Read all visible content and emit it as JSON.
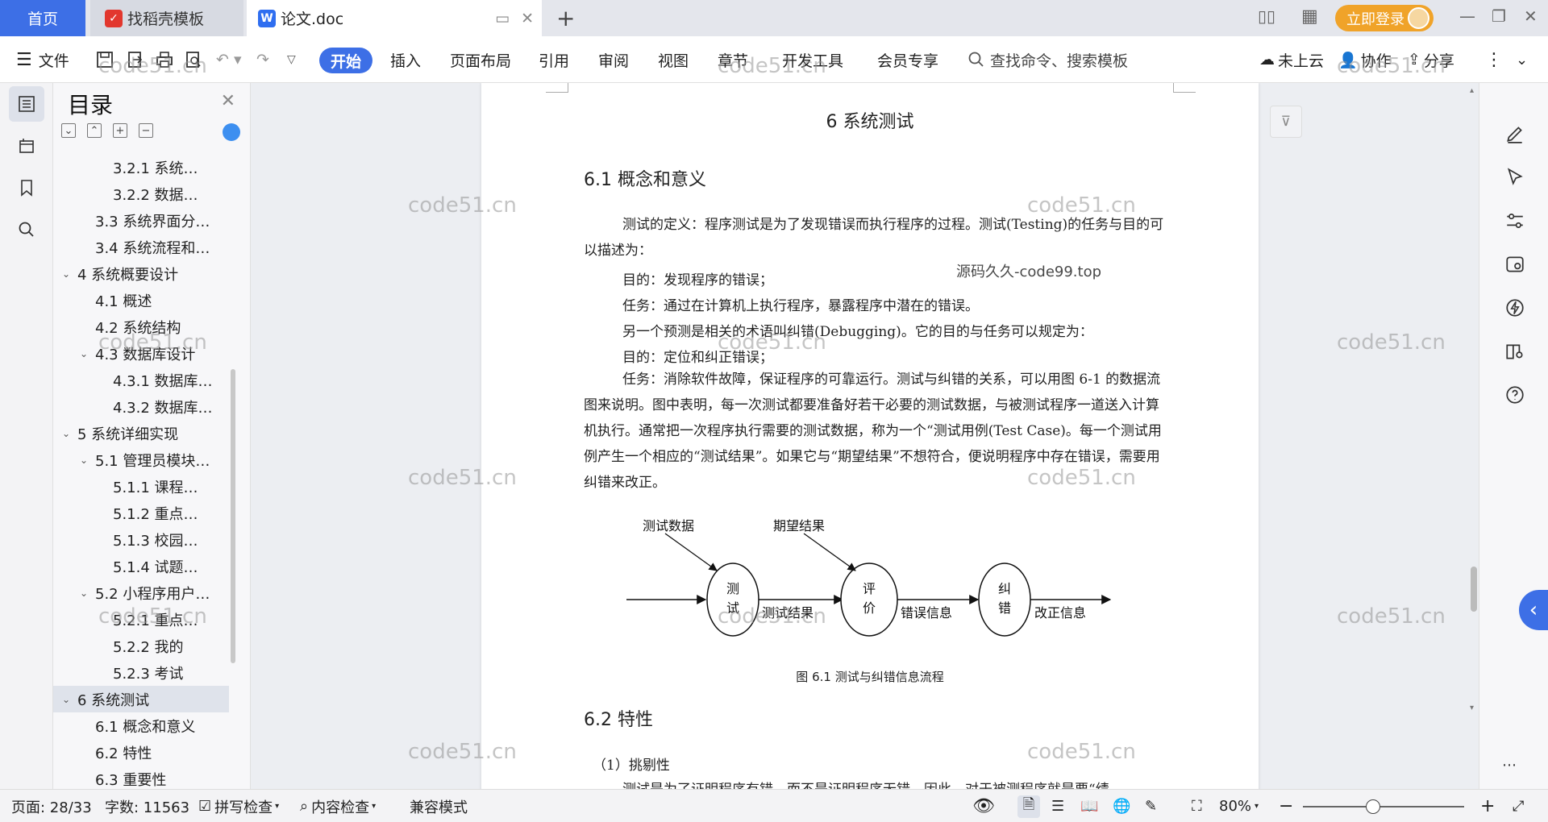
{
  "tabs": [
    {
      "label": "首页"
    },
    {
      "label": "找稻壳模板"
    },
    {
      "label": "论文.doc"
    }
  ],
  "header": {
    "login_label": "立即登录"
  },
  "menu": {
    "file_label": "文件",
    "items": [
      "开始",
      "插入",
      "页面布局",
      "引用",
      "审阅",
      "视图",
      "章节",
      "开发工具",
      "会员专享"
    ],
    "search_placeholder": "查找命令、搜索模板",
    "cloud_label": "未上云",
    "collab_label": "协作",
    "share_label": "分享"
  },
  "toc": {
    "title": "目录",
    "items": [
      {
        "label": "3.2.1 系统…",
        "level": 3
      },
      {
        "label": "3.2.2 数据…",
        "level": 3
      },
      {
        "label": "3.3 系统界面分…",
        "level": 2
      },
      {
        "label": "3.4 系统流程和…",
        "level": 2
      },
      {
        "label": "4 系统概要设计",
        "level": 1,
        "expanded": true
      },
      {
        "label": "4.1 概述",
        "level": 2
      },
      {
        "label": "4.2 系统结构",
        "level": 2
      },
      {
        "label": "4.3 数据库设计",
        "level": 2,
        "expanded": true
      },
      {
        "label": "4.3.1 数据库…",
        "level": 3
      },
      {
        "label": "4.3.2 数据库…",
        "level": 3
      },
      {
        "label": "5 系统详细实现",
        "level": 1,
        "expanded": true
      },
      {
        "label": "5.1 管理员模块…",
        "level": 2,
        "expanded": true
      },
      {
        "label": "5.1.1 课程…",
        "level": 3
      },
      {
        "label": "5.1.2 重点…",
        "level": 3
      },
      {
        "label": "5.1.3 校园…",
        "level": 3
      },
      {
        "label": "5.1.4 试题…",
        "level": 3
      },
      {
        "label": "5.2 小程序用户…",
        "level": 2,
        "expanded": true
      },
      {
        "label": "5.2.1 重点…",
        "level": 3
      },
      {
        "label": "5.2.2 我的",
        "level": 3
      },
      {
        "label": "5.2.3 考试",
        "level": 3
      },
      {
        "label": "6 系统测试",
        "level": 1,
        "expanded": true,
        "active": true
      },
      {
        "label": "6.1 概念和意义",
        "level": 2
      },
      {
        "label": "6.2 特性",
        "level": 2
      },
      {
        "label": "6.3 重要性",
        "level": 2
      }
    ]
  },
  "document": {
    "chapter_title": "6 系统测试",
    "section_1_title": "6.1 概念和意义",
    "para_1": "测试的定义：程序测试是为了发现错误而执行程序的过程。测试(Testing)的任务与目的可以描述为：",
    "line_1": "目的：发现程序的错误；",
    "line_2": "任务：通过在计算机上执行程序，暴露程序中潜在的错误。",
    "line_3": "另一个预测是相关的术语叫纠错(Debugging)。它的目的与任务可以规定为：",
    "line_4": "目的：定位和纠正错误；",
    "para_2": "任务：消除软件故障，保证程序的可靠运行。测试与纠错的关系，可以用图 6-1 的数据流图来说明。图中表明，每一次测试都要准备好若干必要的测试数据，与被测试程序一道送入计算机执行。通常把一次程序执行需要的测试数据，称为一个“测试用例(Test Case)。每一个测试用例产生一个相应的“测试结果”。如果它与“期望结果”不想符合，便说明程序中存在错误，需要用纠错来改正。",
    "diagram": {
      "test_data": "测试数据",
      "expected": "期望结果",
      "node_test_1": "测",
      "node_test_2": "试",
      "node_eval_1": "评",
      "node_eval_2": "价",
      "node_fix_1": "纠",
      "node_fix_2": "错",
      "test_result": "测试结果",
      "error_info": "错误信息",
      "fix_info": "改正信息"
    },
    "figure_caption": "图 6.1 测试与纠错信息流程",
    "section_2_title": "6.2 特性",
    "sub_1": "（1）挑剔性",
    "cut_line": "测试是为了证明程序有错，而不是证明程序无错。因此，对于被测程序就是要“绩"
  },
  "watermarks": {
    "main": "code51.cn",
    "center": "源码久久-code99.top"
  },
  "status": {
    "page": "页面: 28/33",
    "words": "字数: 11563",
    "spell": "拼写检查",
    "content": "内容检查",
    "compat": "兼容模式",
    "zoom": "80%"
  }
}
